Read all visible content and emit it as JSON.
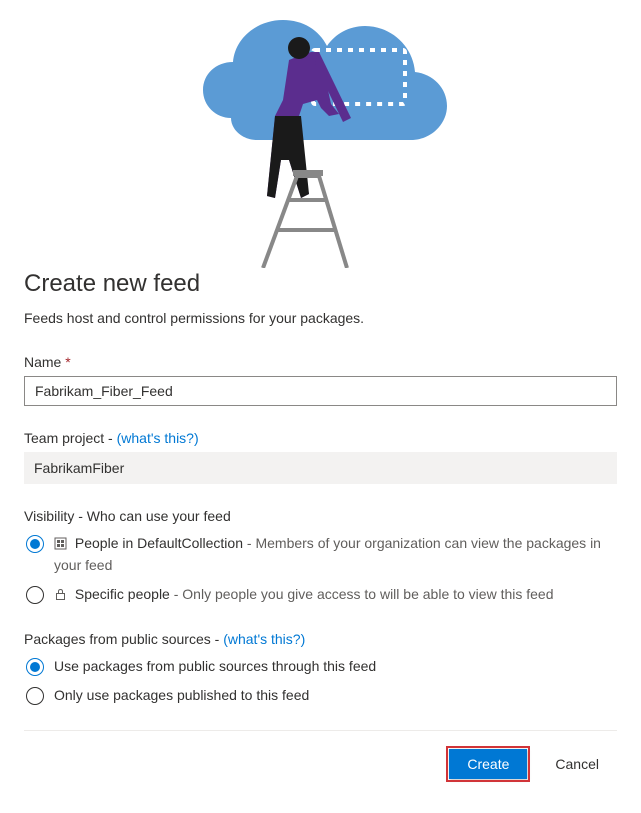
{
  "heading": "Create new feed",
  "subtitle": "Feeds host and control permissions for your packages.",
  "name": {
    "label": "Name",
    "required_marker": "*",
    "value": "Fabrikam_Fiber_Feed"
  },
  "team_project": {
    "label": "Team project -",
    "whats_this": "(what's this?)",
    "value": "FabrikamFiber"
  },
  "visibility": {
    "label": "Visibility - Who can use your feed",
    "options": [
      {
        "title": "People in DefaultCollection",
        "separator": " - ",
        "desc": "Members of your organization can view the packages in your feed",
        "selected": true,
        "icon": "org"
      },
      {
        "title": "Specific people",
        "separator": " - ",
        "desc": "Only people you give access to will be able to view this feed",
        "selected": false,
        "icon": "lock"
      }
    ]
  },
  "public_sources": {
    "label": "Packages from public sources -",
    "whats_this": "(what's this?)",
    "options": [
      {
        "title": "Use packages from public sources through this feed",
        "selected": true
      },
      {
        "title": "Only use packages published to this feed",
        "selected": false
      }
    ]
  },
  "buttons": {
    "create": "Create",
    "cancel": "Cancel"
  }
}
